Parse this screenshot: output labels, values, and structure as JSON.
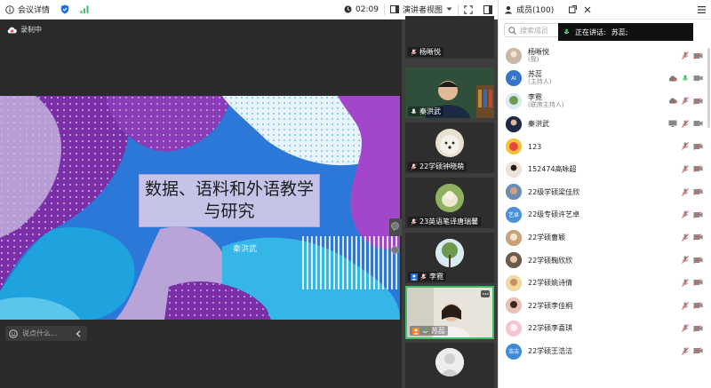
{
  "topbar": {
    "meeting_info": "会议详情",
    "timer": "02:09",
    "view_mode": "演讲者视图"
  },
  "stage": {
    "recording_label": "录制中",
    "slide_title": "数据、语料和外语教学与研究",
    "slide_author": "秦洪武",
    "chat_placeholder": "说点什么..."
  },
  "video_tiles": [
    {
      "name": "杨晰悦"
    },
    {
      "name": "秦洪武"
    },
    {
      "name": "22学硕钟晓萌"
    },
    {
      "name": "23英语笔译唐瑞馨"
    },
    {
      "name": "李霓"
    },
    {
      "name": "苏蕊"
    },
    {
      "name": ""
    }
  ],
  "panel": {
    "title": "成员(100)",
    "search_placeholder": "搜索成员",
    "speaking_now": "正在讲话:",
    "speaking_name": "苏蕊;"
  },
  "members": [
    {
      "name": "杨晰悦",
      "role": "(我)"
    },
    {
      "name": "苏蕊",
      "role": "(主持人)"
    },
    {
      "name": "李霓",
      "role": "(联席主持人)"
    },
    {
      "name": "秦洪武",
      "role": ""
    },
    {
      "name": "123",
      "role": ""
    },
    {
      "name": "152474高咏超",
      "role": ""
    },
    {
      "name": "22级学硕梁佳欣",
      "role": ""
    },
    {
      "name": "22级专硕许艺卓",
      "role": ""
    },
    {
      "name": "22学硕曹颖",
      "role": ""
    },
    {
      "name": "22学硕鞠欣欣",
      "role": ""
    },
    {
      "name": "22学硕姚诗倩",
      "role": ""
    },
    {
      "name": "22学硕李佳桐",
      "role": ""
    },
    {
      "name": "22学硕李喜琪",
      "role": ""
    },
    {
      "name": "22学硕王浩洁",
      "role": ""
    }
  ],
  "avatar_text": {
    "m1": "AI",
    "m7": "艺卓",
    "m13": "浩洁"
  },
  "colors": {
    "accent_green": "#3dbf6a",
    "mic_red": "#e05858",
    "brand_blue": "#1e6fe0"
  }
}
